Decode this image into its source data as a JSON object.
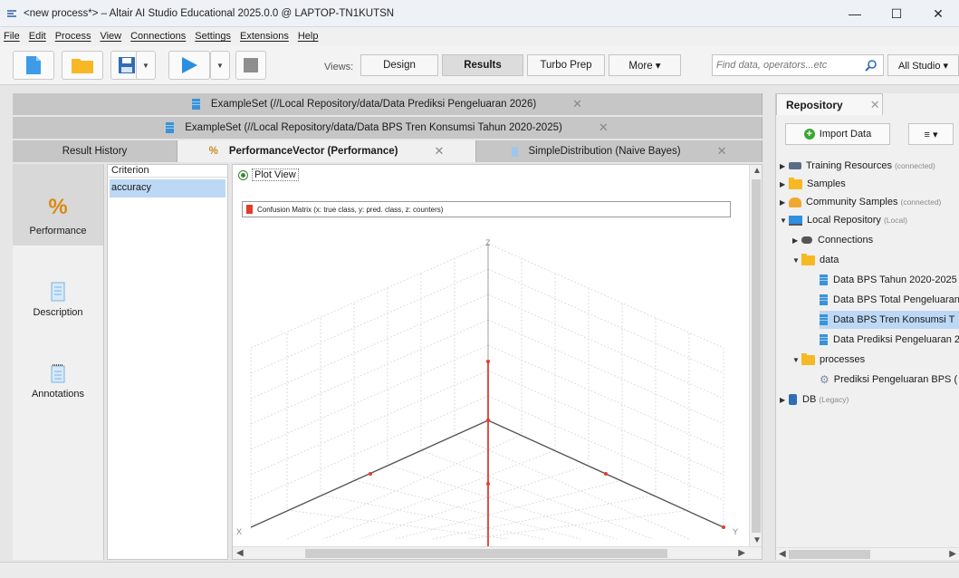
{
  "window": {
    "title": "<new process*> – Altair AI Studio Educational 2025.0.0 @ LAPTOP-TN1KUTSN",
    "minimize": "—",
    "maximize": "☐",
    "close": "✕"
  },
  "menu": [
    "File",
    "Edit",
    "Process",
    "View",
    "Connections",
    "Settings",
    "Extensions",
    "Help"
  ],
  "toolbar": {
    "views_label": "Views:",
    "views": [
      "Design",
      "Results",
      "Turbo Prep",
      "More ▾"
    ],
    "active_view": "Results",
    "search_placeholder": "Find data, operators...etc",
    "perspective": "All Studio ▾"
  },
  "result_tabs": {
    "row1": "ExampleSet (//Local Repository/data/Data Prediksi Pengeluaran 2026)",
    "row2": "ExampleSet (//Local Repository/data/Data BPS Tren Konsumsi Tahun 2020-2025)",
    "row3": [
      "Result History",
      "PerformanceVector (Performance)",
      "SimpleDistribution (Naive Bayes)"
    ],
    "close": "✕"
  },
  "leftnav": {
    "items": [
      "Performance",
      "Description",
      "Annotations"
    ],
    "active": "Performance"
  },
  "criterion": {
    "header": "Criterion",
    "items": [
      "accuracy"
    ]
  },
  "plot": {
    "radio_label": "Plot View",
    "legend": "Confusion Matrix (x: true class,  y: pred. class,  z: counters)",
    "axes": {
      "x": "X",
      "y": "Y",
      "z": "Z"
    },
    "accent": "#e23b2e"
  },
  "repository": {
    "tab": "Repository",
    "import_label": "Import Data",
    "menu_label": "≡ ▾",
    "tree": [
      {
        "label": "Training Resources",
        "sub": "(connected)"
      },
      {
        "label": "Samples",
        "sub": ""
      },
      {
        "label": "Community Samples",
        "sub": "(connected)"
      },
      {
        "label": "Local Repository",
        "sub": "(Local)"
      },
      {
        "label": "Connections",
        "sub": ""
      },
      {
        "label": "data",
        "sub": ""
      },
      {
        "label": "Data BPS Tahun 2020-2025",
        "sub": ""
      },
      {
        "label": "Data BPS Total Pengeluaran",
        "sub": ""
      },
      {
        "label": "Data BPS Tren Konsumsi T",
        "sub": ""
      },
      {
        "label": "Data Prediksi Pengeluaran 2",
        "sub": ""
      },
      {
        "label": "processes",
        "sub": ""
      },
      {
        "label": "Prediksi Pengeluaran BPS (",
        "sub": ""
      },
      {
        "label": "DB",
        "sub": "(Legacy)"
      }
    ]
  }
}
